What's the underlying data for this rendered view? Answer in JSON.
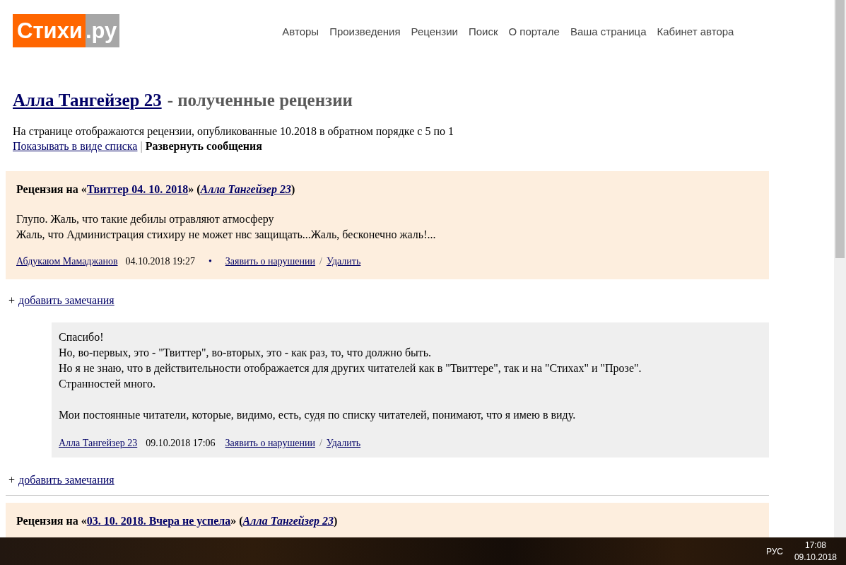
{
  "logo": {
    "main": "Стихи",
    "suffix": ".ру"
  },
  "nav": [
    {
      "label": "Авторы"
    },
    {
      "label": "Произведения"
    },
    {
      "label": "Рецензии"
    },
    {
      "label": "Поиск"
    },
    {
      "label": "О портале"
    },
    {
      "label": "Ваша страница"
    },
    {
      "label": "Кабинет автора"
    }
  ],
  "heading": {
    "author": "Алла Тангейзер 23",
    "rest": "- полученные рецензии"
  },
  "intro": "На странице отображаются рецензии, опубликованные 10.2018 в обратном порядке с 5 по 1",
  "view_links": {
    "list": "Показывать в виде списка",
    "separator": "|",
    "expand": "Развернуть сообщения"
  },
  "reviews": [
    {
      "prefix": "Рецензия на «",
      "work": "Твиттер 04. 10. 2018",
      "middle": "» (",
      "author": "Алла Тангейзер 23",
      "suffix": ")",
      "body": [
        "Глупо. Жаль, что такие дебилы отравляют атмосферу",
        "Жаль, что Администрация стихиру не может нвс защищать...Жаль, бесконечно жаль!..."
      ],
      "footer": {
        "reviewer": "Абдукаюм Мамаджанов",
        "date": "04.10.2018 19:27",
        "bullet": "•",
        "report": "Заявить о нарушении",
        "slash": "/",
        "delete": "Удалить"
      },
      "add_note": {
        "plus": "+",
        "link": "добавить замечания"
      },
      "replies": [
        {
          "paragraphs": [
            [
              "Спасибо!",
              "Но, во-первых, это - \"Твиттер\", во-вторых, это - как раз, то, что должно быть.",
              "Но я не знаю, что в действительности отображается для других читателей как в \"Твиттере\", так и на \"Стихах\" и \"Прозе\".",
              "Странностей много."
            ],
            [
              "Мои постоянные читатели, которые, видимо, есть, судя по списку читателей, понимают, что я имею в виду."
            ]
          ],
          "footer": {
            "author": "Алла Тангейзер 23",
            "date": "09.10.2018 17:06",
            "report": "Заявить о нарушении",
            "slash": "/",
            "delete": "Удалить"
          },
          "add_note": {
            "plus": "+",
            "link": "добавить замечания"
          }
        }
      ]
    },
    {
      "prefix": "Рецензия на «",
      "work": "03. 10. 2018. Вчера не успела",
      "middle": "» (",
      "author": "Алла Тангейзер 23",
      "suffix": ")"
    }
  ],
  "taskbar": {
    "language": "РУС",
    "time": "17:08",
    "date": "09.10.2018"
  }
}
